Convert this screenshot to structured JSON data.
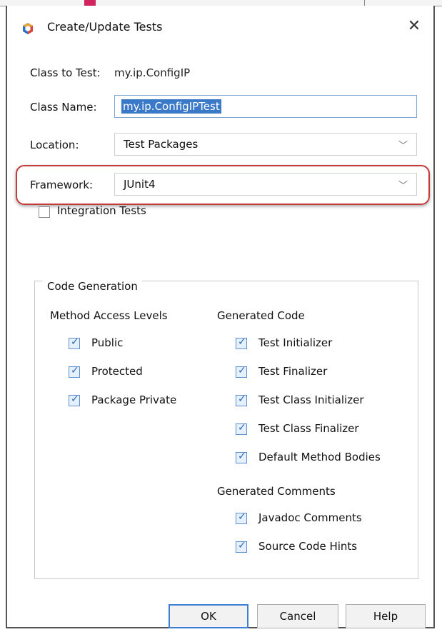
{
  "dialog": {
    "title": "Create/Update Tests",
    "close_glyph": "✕",
    "icon": "netbeans-cube-icon",
    "accent_color": "#3a78c8",
    "highlight_color": "#c43b3b"
  },
  "form": {
    "class_to_test_label": "Class to Test:",
    "class_to_test_value": "my.ip.ConfigIP",
    "class_name_label": "Class Name:",
    "class_name_value": "my.ip.ConfigIPTest",
    "location_label": "Location:",
    "location_value": "Test Packages",
    "framework_label": "Framework:",
    "framework_value": "JUnit4",
    "integration_tests_label": "Integration Tests",
    "integration_tests_checked": false,
    "dropdown_glyph": "﹀"
  },
  "code_generation": {
    "title": "Code Generation",
    "method_access_levels": {
      "heading": "Method Access Levels",
      "items": [
        {
          "label": "Public",
          "checked": true
        },
        {
          "label": "Protected",
          "checked": true
        },
        {
          "label": "Package Private",
          "checked": true
        }
      ]
    },
    "generated_code": {
      "heading": "Generated Code",
      "items": [
        {
          "label": "Test Initializer",
          "checked": true
        },
        {
          "label": "Test Finalizer",
          "checked": true
        },
        {
          "label": "Test Class Initializer",
          "checked": true
        },
        {
          "label": "Test Class Finalizer",
          "checked": true
        },
        {
          "label": "Default Method Bodies",
          "checked": true
        }
      ]
    },
    "generated_comments": {
      "heading": "Generated Comments",
      "items": [
        {
          "label": "Javadoc Comments",
          "checked": true
        },
        {
          "label": "Source Code Hints",
          "checked": true
        }
      ]
    }
  },
  "buttons": {
    "ok": "OK",
    "cancel": "Cancel",
    "help": "Help"
  }
}
